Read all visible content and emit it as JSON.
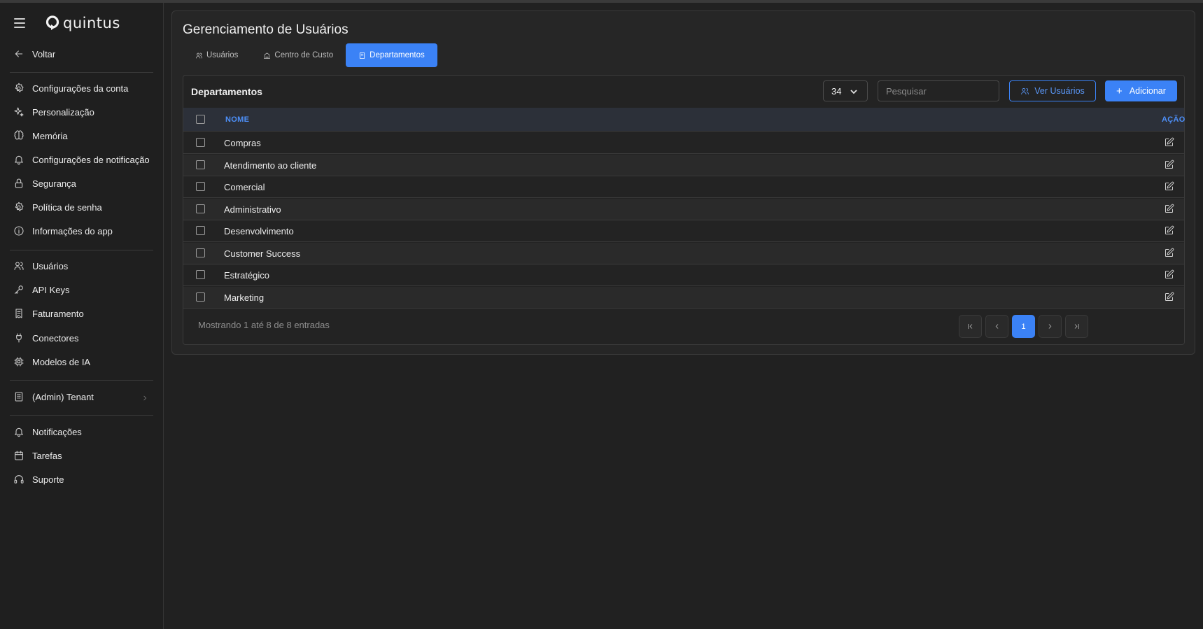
{
  "brand": {
    "name": "quintus"
  },
  "sidebar": {
    "back_label": "Voltar",
    "group1": [
      {
        "label": "Configurações da conta",
        "icon": "settings-icon"
      },
      {
        "label": "Personalização",
        "icon": "sparkles-icon"
      },
      {
        "label": "Memória",
        "icon": "brain-icon"
      },
      {
        "label": "Configurações de notificação",
        "icon": "bell-icon"
      },
      {
        "label": "Segurança",
        "icon": "lock-icon"
      },
      {
        "label": "Política de senha",
        "icon": "settings-icon"
      },
      {
        "label": "Informações do app",
        "icon": "info-icon"
      }
    ],
    "group2": [
      {
        "label": "Usuários",
        "icon": "users-icon"
      },
      {
        "label": "API Keys",
        "icon": "key-icon"
      },
      {
        "label": "Faturamento",
        "icon": "receipt-icon"
      },
      {
        "label": "Conectores",
        "icon": "plug-icon"
      },
      {
        "label": "Modelos de IA",
        "icon": "cpu-icon"
      }
    ],
    "tenant_label": "(Admin) Tenant",
    "group3": [
      {
        "label": "Notificações",
        "icon": "bell-icon"
      },
      {
        "label": "Tarefas",
        "icon": "calendar-icon"
      },
      {
        "label": "Suporte",
        "icon": "headset-icon"
      }
    ]
  },
  "page": {
    "title": "Gerenciamento de Usuários",
    "tabs": [
      {
        "label": "Usuários",
        "icon": "users-icon",
        "active": false
      },
      {
        "label": "Centro de Custo",
        "icon": "building-icon",
        "active": false
      },
      {
        "label": "Departamentos",
        "icon": "building-icon",
        "active": true
      }
    ]
  },
  "table": {
    "title": "Departamentos",
    "per_page": "34",
    "search_placeholder": "Pesquisar",
    "view_users_label": "Ver Usuários",
    "add_label": "Adicionar",
    "columns": {
      "name": "NOME",
      "action": "AÇÃO"
    },
    "rows": [
      "Compras",
      "Atendimento ao cliente",
      "Comercial",
      "Administrativo",
      "Desenvolvimento",
      "Customer Success",
      "Estratégico",
      "Marketing"
    ],
    "footer_info": "Mostrando 1 até 8 de 8 entradas",
    "current_page": "1"
  },
  "colors": {
    "accent": "#3b82f6",
    "background": "#212121",
    "card": "#262626"
  }
}
